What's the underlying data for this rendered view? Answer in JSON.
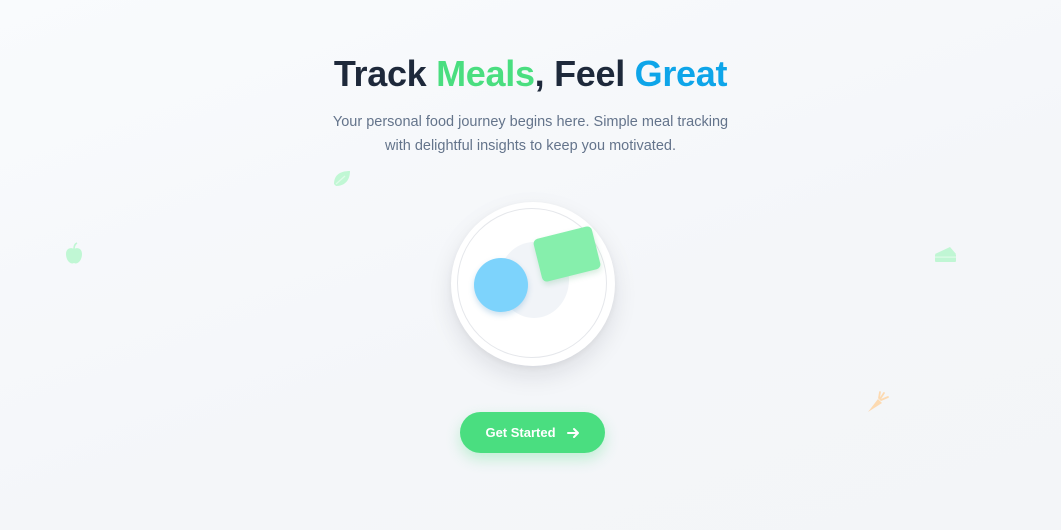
{
  "hero": {
    "title_part1": "Track ",
    "title_accent1": "Meals",
    "title_part2": ", Feel ",
    "title_accent2": "Great",
    "subtitle_line1": "Your personal food journey begins here. Simple meal tracking",
    "subtitle_line2": "with delightful insights to keep you motivated."
  },
  "cta": {
    "label": "Get Started",
    "icon": "arrow-right-icon"
  },
  "decorations": {
    "icons": [
      "leaf-icon",
      "apple-icon",
      "cake-slice-icon",
      "carrot-icon"
    ]
  },
  "colors": {
    "accent_green": "#4ade80",
    "accent_blue": "#0ea5e9",
    "heading": "#1e293b",
    "body_text": "#64748b"
  }
}
